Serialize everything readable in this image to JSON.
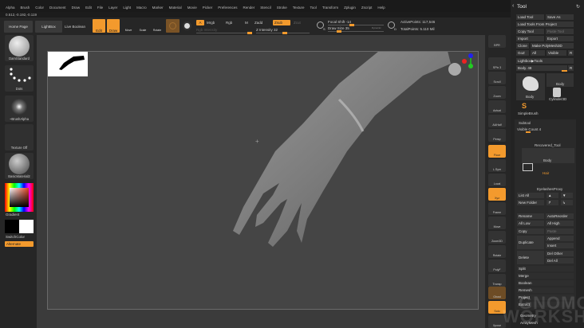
{
  "menu": [
    "Alpha",
    "Brush",
    "Color",
    "Document",
    "Draw",
    "Edit",
    "File",
    "Layer",
    "Light",
    "Macro",
    "Marker",
    "Material",
    "Movie",
    "Picker",
    "Preferences",
    "Render",
    "Stencil",
    "Stroke",
    "Texture",
    "Tool",
    "Transform",
    "Zplugin",
    "Zscript",
    "Help"
  ],
  "coords": "0.512,-0.192,-0.119",
  "top": {
    "home": "Home Page",
    "lightbox": "LightBox",
    "live_boolean": "Live Boolean",
    "edit": "Edit",
    "draw": "Draw",
    "move": "Move",
    "scale": "Scale",
    "rotate": "Rotate",
    "a": "A",
    "mrgb": "Mrgb",
    "rgb": "Rgb",
    "m": "M",
    "zadd": "Zadd",
    "zsub": "Zsub",
    "zcut": "Zcut",
    "rgb_intensity": "Rgb Intensity",
    "z_intensity": "Z Intensity 32",
    "focal_shift": "Focal Shift -14",
    "draw_size": "Draw Size 35",
    "dynamic": "Dynamic",
    "active_points": "ActivePoints: 117,546",
    "total_points": "TotalPoints: 5.110 Mil",
    "s": "S",
    "d": "D"
  },
  "progress": {
    "z_intensity": 32,
    "focal_shift": -14,
    "draw_size": 35
  },
  "left": {
    "brush": "DamStandard",
    "stroke": "Dots",
    "alpha": "~BrushAlpha",
    "texture": "Texture Off",
    "material": "BasicMaterial2",
    "gradient": "Gradient",
    "switch": "SwitchColor",
    "alternate": "Alternate"
  },
  "right_shelf": [
    "BPR",
    "SPix 3",
    "Scroll",
    "Zoom",
    "Actual",
    "AAHalf",
    "Persp",
    "Floor",
    "L.Sym",
    "Local",
    "Xyz",
    "Frame",
    "Move",
    "Zoom3D",
    "Rotate",
    "PolyF",
    "Transp",
    "Ghost",
    "Solo",
    "Xpose"
  ],
  "tool": {
    "title": "Tool",
    "load_tool": "Load Tool",
    "save_as": "Save As",
    "load_project": "Load Tools From Project",
    "copy_tool": "Copy Tool",
    "paste_tool": "Paste Tool",
    "import": "Import",
    "export": "Export",
    "clone": "Clone",
    "make_polymesh": "Make PolyMesh3D",
    "goz": "GoZ",
    "all": "All",
    "visible": "Visible",
    "r": "R",
    "lightbox_tools": "Lightbox▶Tools",
    "body_slider": "Body. 48",
    "thumb_body": "Body",
    "thumb_body2": "Body",
    "thumb_cylinder": "Cylinder3D",
    "thumb_simple": "SimpleBrush"
  },
  "subtool": {
    "title": "Subtool",
    "visible_count": "Visible Count 4",
    "items": [
      "Recovered_Tool",
      "Body",
      "Hair",
      "EyelashesProxy"
    ],
    "list_all": "List All",
    "new_folder": "New Folder",
    "rename": "Rename",
    "autoreorder": "AutoReorder",
    "all_low": "All Low",
    "all_high": "All High",
    "copy": "Copy",
    "paste": "Paste",
    "duplicate": "Duplicate",
    "append": "Append",
    "insert": "Insert",
    "delete": "Delete",
    "del_other": "Del Other",
    "del_all": "Del All",
    "split": "Split",
    "merge": "Merge",
    "boolean": "Boolean",
    "remesh": "Remesh",
    "project": "Project",
    "extract": "Extract",
    "geometry": "Geometry",
    "arraymesh": "ArrayMesh"
  },
  "watermark": {
    "line1": "GNOMON",
    "line2": "WORKSHOP"
  }
}
